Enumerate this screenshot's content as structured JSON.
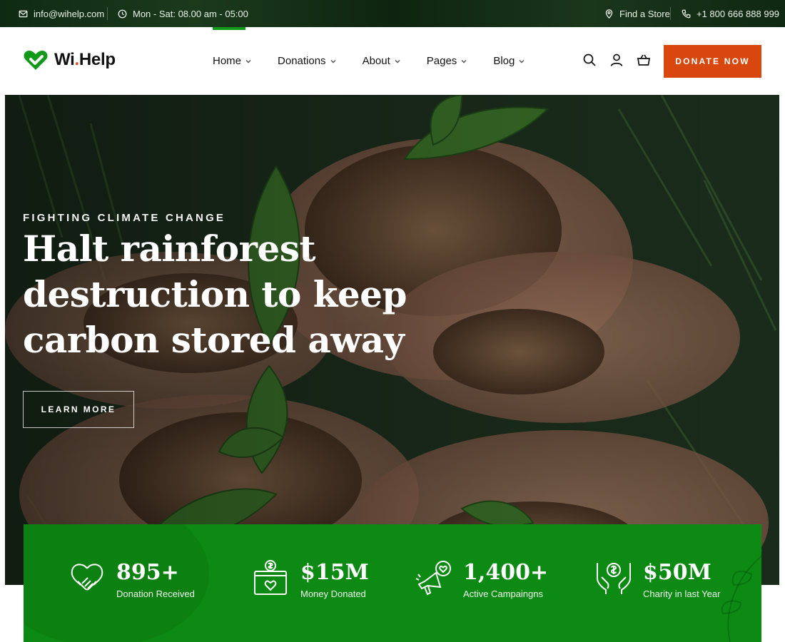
{
  "topbar": {
    "email": "info@wihelp.com",
    "hours": "Mon - Sat: 08.00 am - 05:00",
    "store": "Find a Store",
    "phone": "+1 800 666 888 999"
  },
  "brand": {
    "name_main": "Wi",
    "name_dot": ".",
    "name_rest": "Help",
    "accent": "#e04a11",
    "green": "#119a19"
  },
  "nav": {
    "items": [
      {
        "label": "Home"
      },
      {
        "label": "Donations"
      },
      {
        "label": "About"
      },
      {
        "label": "Pages"
      },
      {
        "label": "Blog"
      }
    ],
    "active": "Home"
  },
  "header": {
    "donate_label": "DONATE NOW",
    "icons": [
      "search-icon",
      "user-icon",
      "cart-icon"
    ]
  },
  "hero": {
    "eyebrow": "FIGHTING CLIMATE CHANGE",
    "headline": "Halt rainforest destruction to keep carbon stored away",
    "cta": "LEARN MORE"
  },
  "stats": [
    {
      "value": "895+",
      "label": "Donation Received",
      "icon": "handshake-heart-icon"
    },
    {
      "value": "$15M",
      "label": "Money Donated",
      "icon": "donation-box-icon"
    },
    {
      "value": "1,400+",
      "label": "Active Campaingns",
      "icon": "megaphone-icon"
    },
    {
      "value": "$50M",
      "label": "Charity in last Year",
      "icon": "hands-coin-icon"
    }
  ],
  "colors": {
    "donate_button": "#d8480e",
    "stats_band": "#0d8a13",
    "topbar": "#143018"
  }
}
